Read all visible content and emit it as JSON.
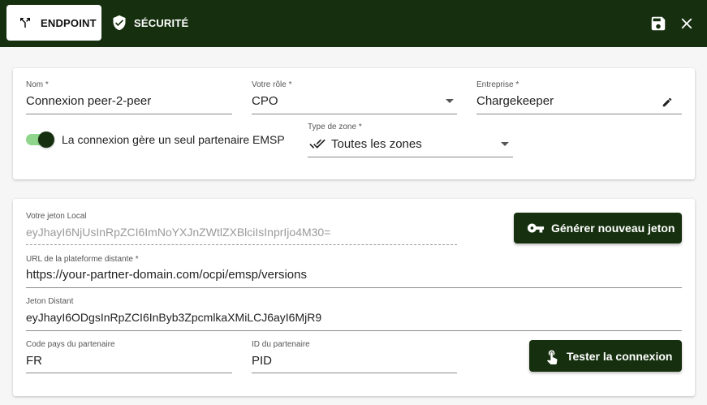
{
  "topbar": {
    "tabs": [
      {
        "label": "ENDPOINT",
        "icon": "fork-arrows-icon",
        "active": true
      },
      {
        "label": "SÉCURITÉ",
        "icon": "shield-check-icon",
        "active": false
      }
    ],
    "actions": {
      "save_icon": "floppy-disk-icon",
      "close_icon": "close-icon"
    }
  },
  "general": {
    "name": {
      "label": "Nom *",
      "value": "Connexion peer-2-peer"
    },
    "role": {
      "label": "Votre rôle *",
      "value": "CPO"
    },
    "company": {
      "label": "Entreprise *",
      "value": "Chargekeeper"
    },
    "single_partner": {
      "label": "La connexion gère un seul partenaire EMSP",
      "checked": true
    },
    "zone_type": {
      "label": "Type de zone *",
      "value": "Toutes les zones"
    }
  },
  "connection": {
    "local_token": {
      "label": "Votre jeton Local",
      "value": "eyJhayI6NjUsInRpZCI6ImNoYXJnZWtlZXBlciIsInprIjo4M30="
    },
    "generate_button": "Générer nouveau jeton",
    "remote_url": {
      "label": "URL de la plateforme distante *",
      "value": "https://your-partner-domain.com/ocpi/emsp/versions"
    },
    "remote_token": {
      "label": "Jeton Distant",
      "value": "eyJhayI6ODgsInRpZCI6InByb3ZpcmlkaXMiLCJ6ayI6MjR9"
    },
    "partner_country": {
      "label": "Code pays du partenaire",
      "value": "FR"
    },
    "partner_id": {
      "label": "ID du partenaire",
      "value": "PID"
    },
    "test_button": "Tester la connexion"
  },
  "colors": {
    "primary": "#16300f",
    "toggle_track": "#8fd68c"
  }
}
